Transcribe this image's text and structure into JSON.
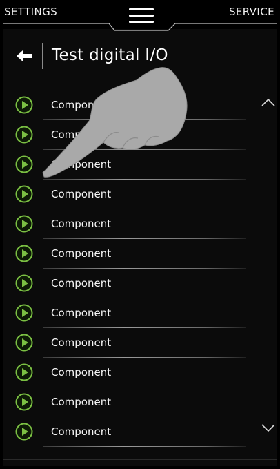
{
  "topbar": {
    "left_label": "SETTINGS",
    "right_label": "SERVICE",
    "menu_icon": "hamburger-menu-icon"
  },
  "header": {
    "back_icon": "back-arrow-icon",
    "title": "Test digital I/O"
  },
  "list": {
    "item_icon": "play-circle-icon",
    "accent_color": "#7bc043",
    "items": [
      {
        "label": "Component"
      },
      {
        "label": "Component"
      },
      {
        "label": "Component"
      },
      {
        "label": "Component"
      },
      {
        "label": "Component"
      },
      {
        "label": "Component"
      },
      {
        "label": "Component"
      },
      {
        "label": "Component"
      },
      {
        "label": "Component"
      },
      {
        "label": "Component"
      },
      {
        "label": "Component"
      },
      {
        "label": "Component"
      }
    ]
  },
  "scrollbar": {
    "up_icon": "chevron-up-icon",
    "down_icon": "chevron-down-icon"
  },
  "overlay": {
    "hand_icon": "pointing-hand-icon"
  }
}
